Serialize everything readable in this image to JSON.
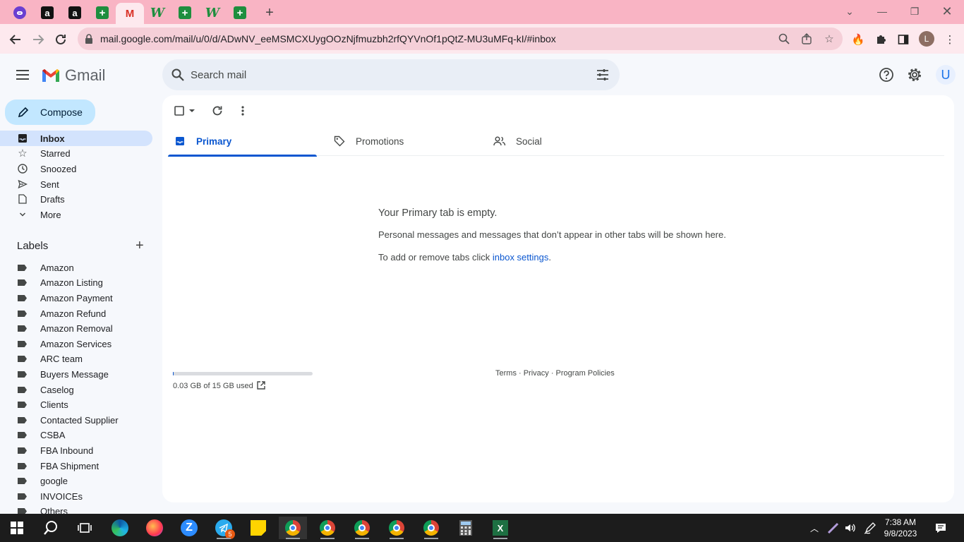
{
  "browser": {
    "tabs": [
      {
        "icon": "purple-circle-icon"
      },
      {
        "icon": "amazon-icon",
        "glyph": "a"
      },
      {
        "icon": "amazon-icon",
        "glyph": "a"
      },
      {
        "icon": "sheets-icon",
        "glyph": "+"
      },
      {
        "icon": "gmail-icon",
        "glyph": "M",
        "active": true
      },
      {
        "icon": "w-icon",
        "glyph": "W"
      },
      {
        "icon": "sheets-icon",
        "glyph": "+"
      },
      {
        "icon": "w-icon",
        "glyph": "W"
      },
      {
        "icon": "sheets-icon",
        "glyph": "+"
      }
    ],
    "url": "mail.google.com/mail/u/0/d/ADwNV_eeMSMCXUygOOzNjfmuzbh2rfQYVnOf1pQtZ-MU3uMFq-kI/#inbox",
    "profile_initial": "L"
  },
  "gmail": {
    "brand": "Gmail",
    "search_placeholder": "Search mail",
    "account_initial": "U",
    "compose_label": "Compose",
    "nav": [
      {
        "label": "Inbox",
        "icon": "inbox-icon",
        "active": true
      },
      {
        "label": "Starred",
        "icon": "star-icon"
      },
      {
        "label": "Snoozed",
        "icon": "clock-icon"
      },
      {
        "label": "Sent",
        "icon": "send-icon"
      },
      {
        "label": "Drafts",
        "icon": "draft-icon"
      },
      {
        "label": "More",
        "icon": "chevron-down-icon"
      }
    ],
    "labels_heading": "Labels",
    "labels": [
      "Amazon",
      "Amazon Listing",
      "Amazon Payment",
      "Amazon Refund",
      "Amazon Removal",
      "Amazon Services",
      "ARC team",
      "Buyers Message",
      "Caselog",
      "Clients",
      "Contacted Supplier",
      "CSBA",
      "FBA Inbound",
      "FBA Shipment",
      "google",
      "INVOICEs",
      "Others"
    ],
    "tabs": [
      {
        "label": "Primary",
        "icon": "inbox-icon",
        "active": true
      },
      {
        "label": "Promotions",
        "icon": "tag-icon"
      },
      {
        "label": "Social",
        "icon": "people-icon"
      }
    ],
    "empty": {
      "title": "Your Primary tab is empty.",
      "description": "Personal messages and messages that don’t appear in other tabs will be shown here.",
      "hint_prefix": "To add or remove tabs click ",
      "hint_link": "inbox settings",
      "hint_suffix": "."
    },
    "storage": {
      "text": "0.03 GB of 15 GB used",
      "used_fraction": 0.002
    },
    "footer": "Terms · Privacy · Program Policies"
  },
  "taskbar": {
    "time": "7:38 AM",
    "date": "9/8/2023",
    "telegram_badge": "5"
  }
}
